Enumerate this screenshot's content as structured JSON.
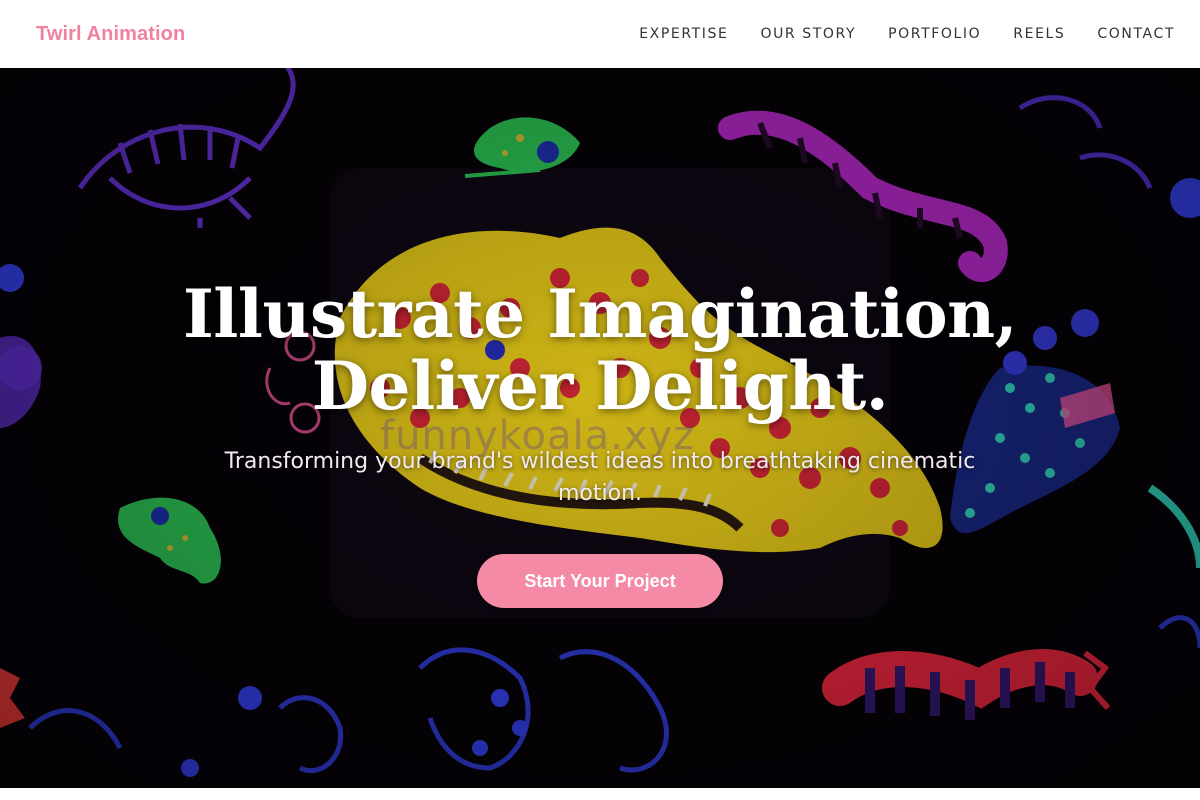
{
  "nav": {
    "brand": "Twirl Animation",
    "links": [
      {
        "label": "EXPERTISE"
      },
      {
        "label": "OUR STORY"
      },
      {
        "label": "PORTFOLIO"
      },
      {
        "label": "REELS"
      },
      {
        "label": "CONTACT"
      }
    ]
  },
  "hero": {
    "headline_line1": "Illustrate Imagination,",
    "headline_line2": "Deliver Delight.",
    "subheadline": "Transforming your brand's wildest ideas into breathtaking cinematic motion.",
    "cta_label": "Start Your Project",
    "watermark": "funnykoala.xyz"
  },
  "colors": {
    "brand_pink": "#f0829f",
    "cta_pink": "#f48aa6",
    "hero_bg": "#060208",
    "nav_text": "#333333"
  }
}
